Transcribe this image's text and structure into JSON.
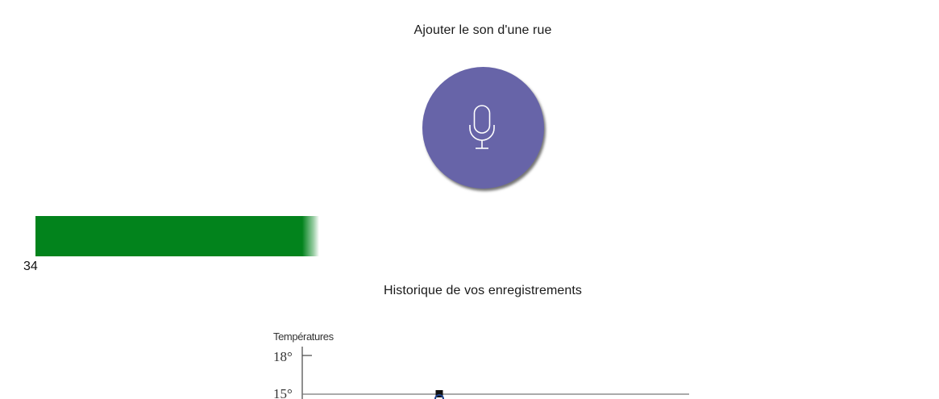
{
  "add_section": {
    "title": "Ajouter le son d'une rue"
  },
  "record_button": {
    "icon": "microphone-icon",
    "color": "#6764a8"
  },
  "sound_level": {
    "value": "34",
    "fill_fraction": 0.3,
    "color": "#02831c"
  },
  "history_section": {
    "title": "Historique de vos enregistrements"
  },
  "chart_data": {
    "type": "line",
    "ylabel": "Températures",
    "y_ticks": [
      "18°",
      "15°"
    ],
    "series": [
      {
        "x": [
          1
        ],
        "y": [
          15
        ]
      }
    ],
    "grid": false
  }
}
